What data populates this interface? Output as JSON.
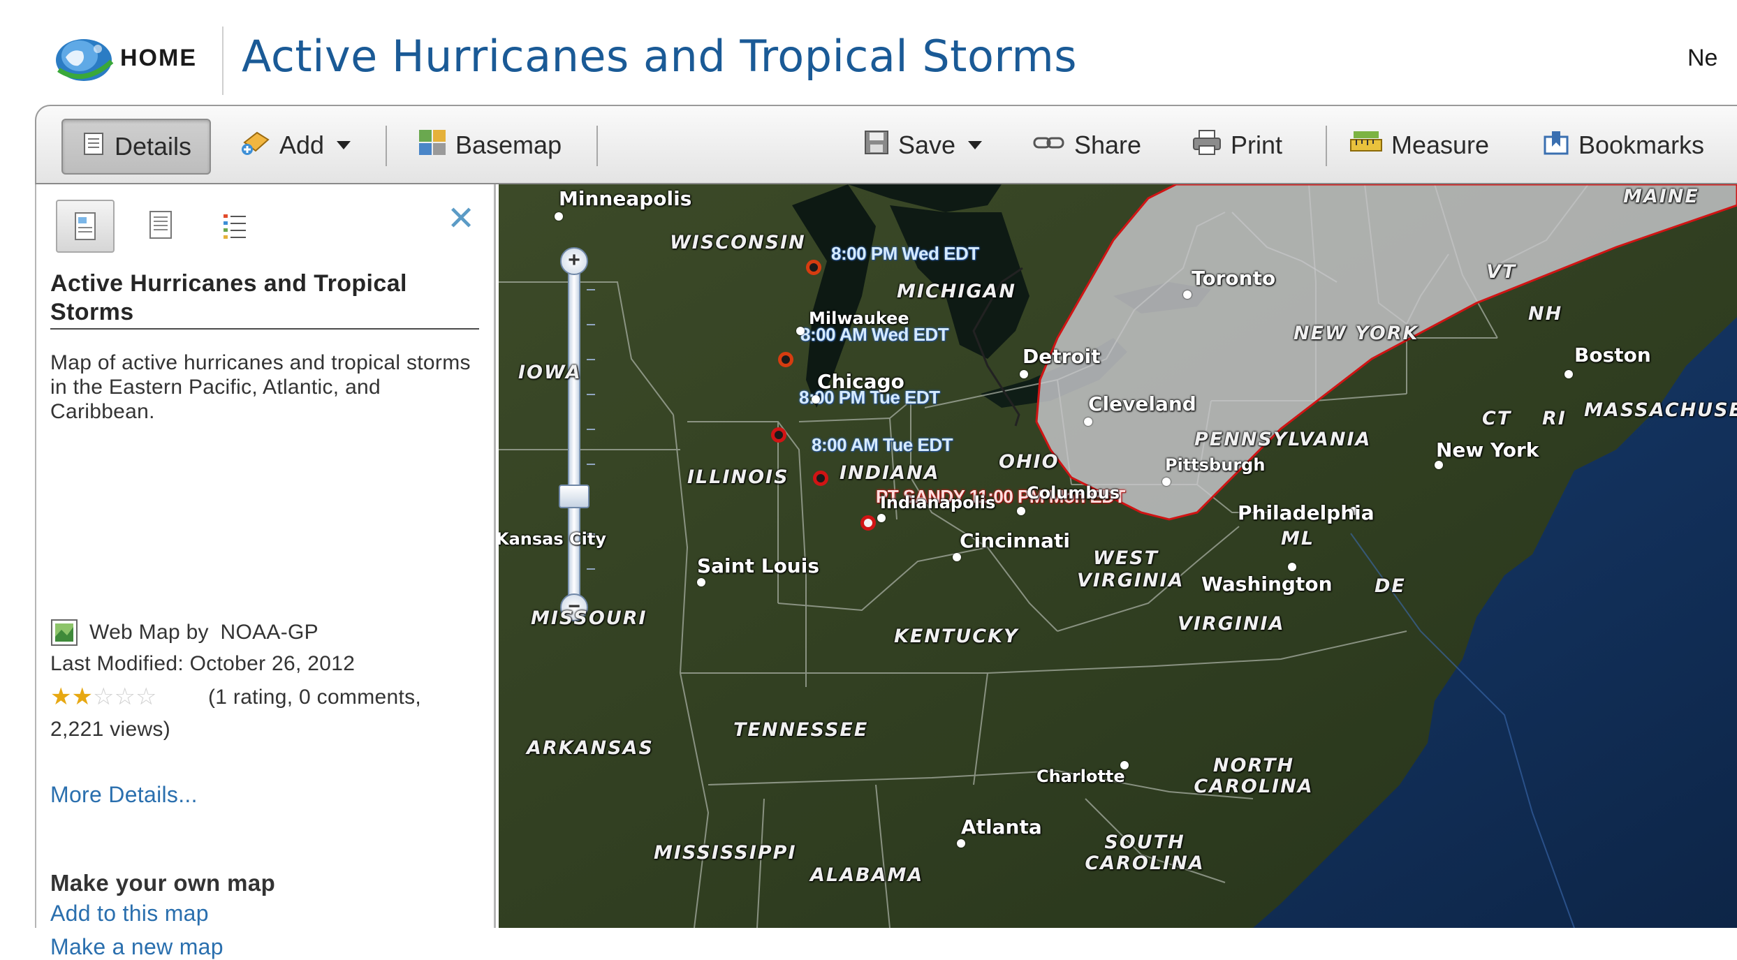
{
  "header": {
    "home_label": "HOME",
    "title": "Active Hurricanes and Tropical Storms",
    "right_text": "Ne"
  },
  "toolbar": {
    "details": "Details",
    "add": "Add",
    "basemap": "Basemap",
    "save": "Save",
    "share": "Share",
    "print": "Print",
    "measure": "Measure",
    "bookmarks": "Bookmarks"
  },
  "panel": {
    "title": "Active Hurricanes and Tropical Storms",
    "description": "Map of active hurricanes and tropical storms in the Eastern Pacific, Atlantic, and Caribbean.",
    "owner_prefix": "Web Map by ",
    "owner": "NOAA-GP",
    "last_modified": "Last Modified: October 26, 2012",
    "rating": 2,
    "rating_max": 5,
    "rating_text": "(1 rating, 0 comments,",
    "views_text": "2,221 views)",
    "more_details": "More Details...",
    "make_heading": "Make your own map",
    "add_to_map": "Add to this map",
    "make_new_map": "Make a new map"
  },
  "icons": {
    "logo": "globe-logo-icon",
    "details": "document-icon",
    "add": "add-layer-icon",
    "basemap": "basemap-grid-icon",
    "save": "floppy-disk-icon",
    "share": "chain-link-icon",
    "print": "printer-icon",
    "measure": "ruler-icon",
    "bookmarks": "bookmark-icon"
  },
  "colors": {
    "title_blue": "#1a5a96",
    "link_blue": "#2a6fae",
    "star_on": "#e7a812",
    "cone_fill": "#c8c8cc",
    "cone_border": "#d01414",
    "ocean": "#12335e"
  },
  "map": {
    "states": [
      "WISCONSIN",
      "MICHIGAN",
      "IOWA",
      "ILLINOIS",
      "INDIANA",
      "OHIO",
      "WEST VIRGINIA",
      "MISSOURI",
      "KENTUCKY",
      "VIRGINIA",
      "TENNESSEE",
      "ARKANSAS",
      "NORTH CAROLINA",
      "SOUTH CAROLINA",
      "MISSISSIPPI",
      "ALABAMA",
      "MAINE",
      "VT",
      "NH",
      "MASSACHUSE",
      "CT",
      "RI",
      "PENNSYLVANIA",
      "NEW YORK",
      "DE",
      "ML"
    ],
    "cities": [
      "Minneapolis",
      "Milwaukee",
      "Chicago",
      "Detroit",
      "Toronto",
      "Cleveland",
      "Pittsburgh",
      "Boston",
      "New York",
      "Philadelphia",
      "Columbus",
      "Indianapolis",
      "Cincinnati",
      "Washington",
      "Kansas City",
      "Saint Louis",
      "Charlotte",
      "Atlanta"
    ],
    "storm_labels": [
      "8:00 PM Wed EDT",
      "8:00 AM Wed EDT",
      "8:00 PM Tue EDT",
      "8:00 AM Tue EDT",
      "PT SANDY 11:00 PM Mon EDT"
    ]
  }
}
